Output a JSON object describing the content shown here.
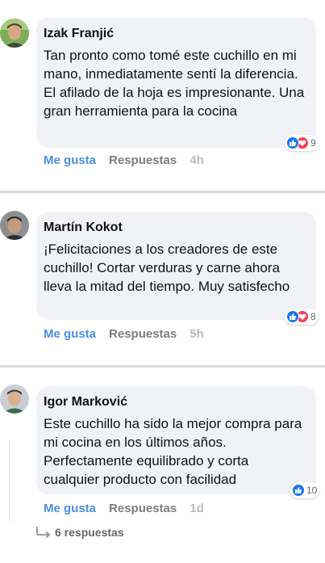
{
  "comments": [
    {
      "author": "Izak Franjić",
      "text": "Tan pronto como tomé este cuchillo en mi mano, inmediatamente sentí la diferencia. El afilado de la hoja es impresionante. Una gran herramienta para la cocina",
      "reaction_count": "9",
      "like_label": "Me gusta",
      "reply_label": "Respuestas",
      "time": "4h"
    },
    {
      "author": "Martín Kokot",
      "text": "¡Felicitaciones a los creadores de este cuchillo! Cortar verduras y carne ahora lleva la mitad del tiempo. Muy satisfecho",
      "reaction_count": "8",
      "like_label": "Me gusta",
      "reply_label": "Respuestas",
      "time": "5h"
    },
    {
      "author": "Igor Marković",
      "text": "Este cuchillo ha sido la mejor compra para mi cocina en los últimos años. Perfectamente equilibrado y corta cualquier producto con facilidad",
      "reaction_count": "10",
      "like_label": "Me gusta",
      "reply_label": "Respuestas",
      "time": "1d"
    }
  ],
  "replies_link": "6 respuestas",
  "colors": {
    "bubble": "#f0f2f5",
    "like_blue": "#4a90e2",
    "love_red": "#f33e58",
    "reaction_blue": "#1877f2"
  },
  "icons": [
    "like-reaction-icon",
    "love-reaction-icon",
    "reply-arrow-icon"
  ]
}
